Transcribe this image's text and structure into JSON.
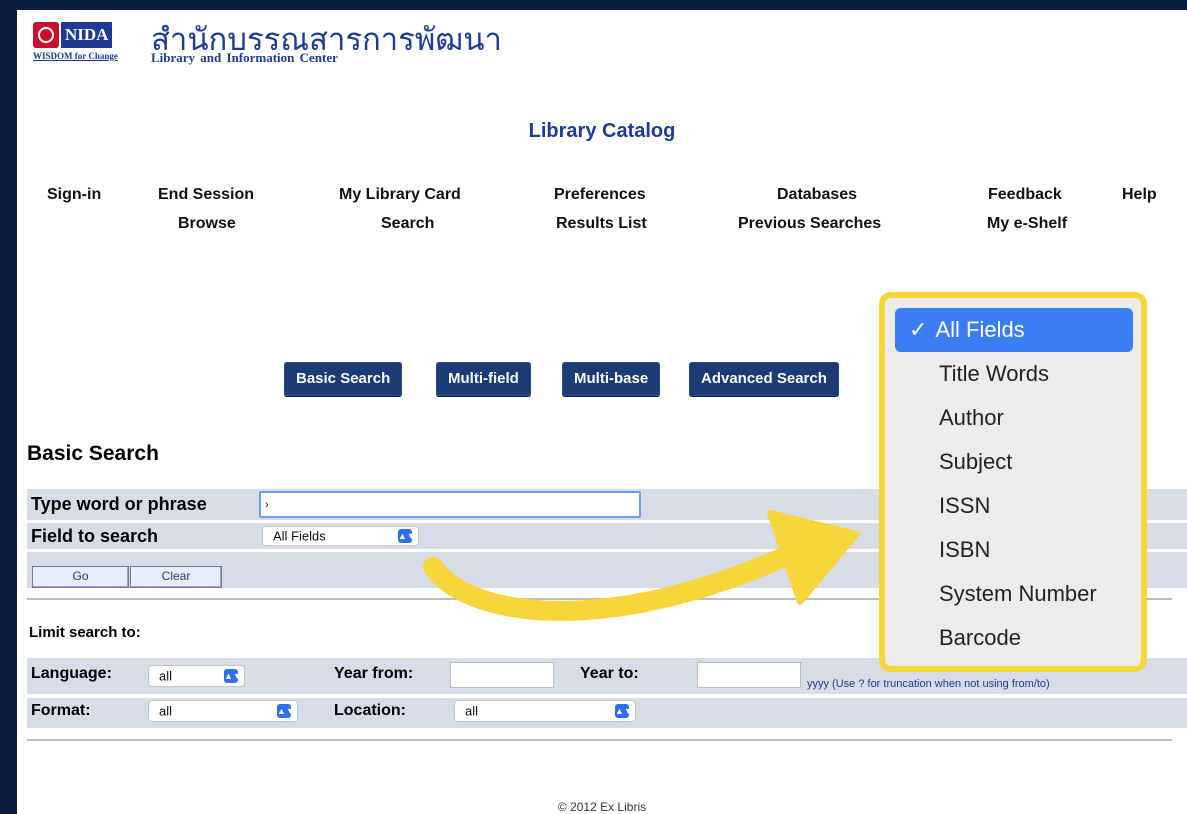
{
  "header": {
    "logo_text": "NIDA",
    "logo_tagline": "WISDOM for Change",
    "thai_title": "สำนักบรรณสารการพัฒนา",
    "english_title": "Library and Information Center",
    "catalog_title": "Library Catalog"
  },
  "nav": {
    "row1": [
      "Sign-in",
      "End Session",
      "My Library Card",
      "Preferences",
      "Databases",
      "Feedback",
      "Help"
    ],
    "row2": [
      "Browse",
      "Search",
      "Results List",
      "Previous Searches",
      "My e-Shelf"
    ]
  },
  "search_tabs": [
    "Basic Search",
    "Multi-field",
    "Multi-base",
    "Advanced Search"
  ],
  "basic_search": {
    "title": "Basic Search",
    "word_label": "Type word or phrase",
    "word_value": "›",
    "field_label": "Field to search",
    "field_value": "All Fields",
    "go_label": "Go",
    "clear_label": "Clear"
  },
  "limits": {
    "title": "Limit search to:",
    "language_label": "Language:",
    "language_value": "all",
    "year_from_label": "Year from:",
    "year_to_label": "Year to:",
    "year_hint": "yyyy (Use ? for truncation when not using from/to)",
    "format_label": "Format:",
    "format_value": "all",
    "location_label": "Location:",
    "location_value": "all"
  },
  "dropdown": {
    "options": [
      "All Fields",
      "Title Words",
      "Author",
      "Subject",
      "ISSN",
      "ISBN",
      "System Number",
      "Barcode"
    ],
    "selected": "All Fields",
    "check": "✓"
  },
  "footer": "© 2012 Ex Libris",
  "colors": {
    "frame": "#0d1b3e",
    "brand_blue": "#1f3a93",
    "tab_button": "#1c3a73",
    "highlight_border": "#f7d63b",
    "arrow": "#f7d63b",
    "selected_option": "#3b7df2"
  },
  "icons": {
    "select_chevron": "select-chevron-icon",
    "arrow": "curved-arrow-icon"
  }
}
